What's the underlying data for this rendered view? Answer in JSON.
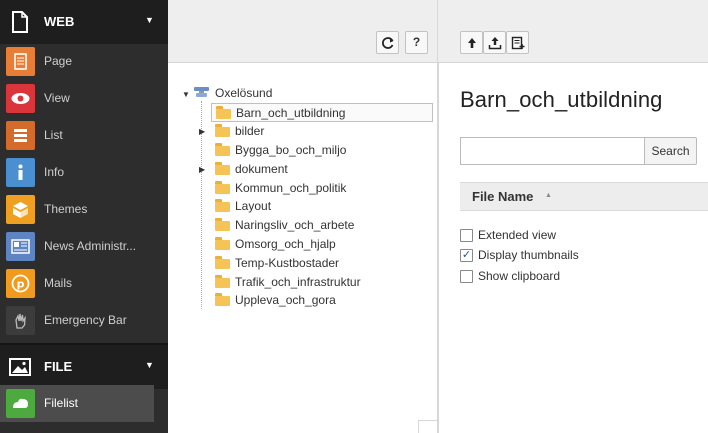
{
  "module_menu": {
    "groups": [
      {
        "label": "WEB",
        "icon": "page-outline-icon"
      },
      {
        "label": "FILE",
        "icon": "image-icon"
      }
    ],
    "web_items": [
      {
        "label": "Page",
        "icon": "page-icon",
        "color": "#e87d36"
      },
      {
        "label": "View",
        "icon": "eye-icon",
        "color": "#d9353a"
      },
      {
        "label": "List",
        "icon": "list-icon",
        "color": "#d46b2b"
      },
      {
        "label": "Info",
        "icon": "info-icon",
        "color": "#4a90d0"
      },
      {
        "label": "Themes",
        "icon": "themes-box-icon",
        "color": "#f0a021"
      },
      {
        "label": "News Administr...",
        "icon": "news-icon",
        "color": "#5e84c4"
      },
      {
        "label": "Mails",
        "icon": "mail-at-icon",
        "color": "#f09a1e"
      },
      {
        "label": "Emergency Bar",
        "icon": "hand-icon",
        "color": "#3c3c3c"
      }
    ],
    "file_items": [
      {
        "label": "Filelist",
        "icon": "filelist-icon",
        "color": "#4caa3e",
        "active": true
      }
    ]
  },
  "tree_toolbar": {
    "refresh_icon": "refresh-icon",
    "help_label": "?"
  },
  "tree": {
    "root": "Oxelösund",
    "nodes": [
      {
        "label": "Barn_och_utbildning",
        "selected": true,
        "expandable": false
      },
      {
        "label": "bilder",
        "selected": false,
        "expandable": true
      },
      {
        "label": "Bygga_bo_och_miljo",
        "selected": false,
        "expandable": false
      },
      {
        "label": "dokument",
        "selected": false,
        "expandable": true
      },
      {
        "label": "Kommun_och_politik",
        "selected": false,
        "expandable": false
      },
      {
        "label": "Layout",
        "selected": false,
        "expandable": false
      },
      {
        "label": "Naringsliv_och_arbete",
        "selected": false,
        "expandable": false
      },
      {
        "label": "Omsorg_och_hjalp",
        "selected": false,
        "expandable": false
      },
      {
        "label": "Temp-Kustbostader",
        "selected": false,
        "expandable": false
      },
      {
        "label": "Trafik_och_infrastruktur",
        "selected": false,
        "expandable": false
      },
      {
        "label": "Uppleva_och_gora",
        "selected": false,
        "expandable": false
      }
    ]
  },
  "content_toolbar": {
    "buttons": [
      "up-level-icon",
      "upload-icon",
      "new-file-icon"
    ]
  },
  "content": {
    "title": "Barn_och_utbildning",
    "search": {
      "placeholder": "",
      "value": "",
      "button_label": "Search"
    },
    "table_header": {
      "column": "File Name",
      "sort": "ascending"
    },
    "options": [
      {
        "label": "Extended view",
        "checked": false
      },
      {
        "label": "Display thumbnails",
        "checked": true
      },
      {
        "label": "Show clipboard",
        "checked": false
      }
    ]
  }
}
